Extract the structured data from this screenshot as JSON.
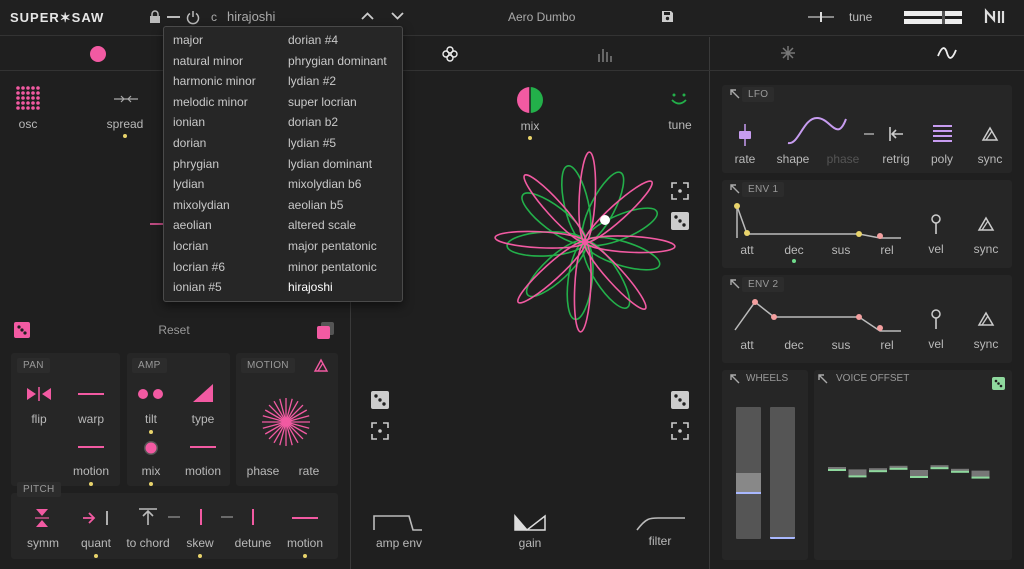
{
  "header": {
    "logo": "SUPER✶SAW",
    "root_note": "c",
    "scale_value": "hirajoshi",
    "preset_name": "Aero Dumbo",
    "tune_label": "tune"
  },
  "scale_menu": {
    "col1": [
      "major",
      "natural minor",
      "harmonic minor",
      "melodic minor",
      "ionian",
      "dorian",
      "phrygian",
      "lydian",
      "mixolydian",
      "aeolian",
      "locrian",
      "locrian #6",
      "ionian #5"
    ],
    "col2": [
      "dorian #4",
      "phrygian dominant",
      "lydian #2",
      "super locrian",
      "dorian b2",
      "lydian #5",
      "lydian dominant",
      "mixolydian b6",
      "aeolian b5",
      "altered scale",
      "major pentatonic",
      "minor pentatonic",
      "hirajoshi"
    ],
    "selected": "hirajoshi"
  },
  "left": {
    "osc_label": "osc",
    "spread_label": "spread",
    "reset_label": "Reset",
    "pan": {
      "title": "PAN",
      "flip": "flip",
      "warp": "warp",
      "motion": "motion"
    },
    "amp": {
      "title": "AMP",
      "tilt": "tilt",
      "type": "type",
      "mix": "mix",
      "motion": "motion"
    },
    "motion": {
      "title": "MOTION",
      "phase": "phase",
      "rate": "rate"
    },
    "pitch": {
      "title": "PITCH",
      "symm": "symm",
      "quant": "quant",
      "to_chord": "to chord",
      "skew": "skew",
      "detune": "detune",
      "motion": "motion"
    }
  },
  "center": {
    "mix_label": "mix",
    "tune_label": "tune",
    "amp_env_label": "amp env",
    "gain_label": "gain",
    "filter_label": "filter"
  },
  "right": {
    "lfo": {
      "title": "LFO",
      "rate": "rate",
      "shape": "shape",
      "phase": "phase",
      "retrig": "retrig",
      "poly": "poly",
      "sync": "sync"
    },
    "env1": {
      "title": "ENV 1",
      "att": "att",
      "dec": "dec",
      "sus": "sus",
      "rel": "rel",
      "vel": "vel",
      "sync": "sync"
    },
    "env2": {
      "title": "ENV 2",
      "att": "att",
      "dec": "dec",
      "sus": "sus",
      "rel": "rel",
      "vel": "vel",
      "sync": "sync"
    },
    "wheels_title": "WHEELS",
    "voice_offset_title": "VOICE OFFSET"
  },
  "colors": {
    "accent_pink": "#f25aa2",
    "accent_green": "#23b04a",
    "indicator_yellow": "#e8d36b",
    "lfo_purple": "#c79cf0"
  }
}
